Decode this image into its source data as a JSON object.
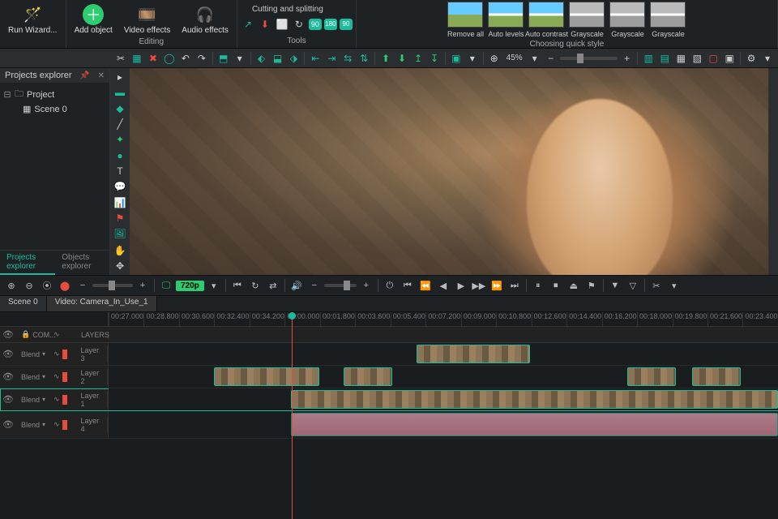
{
  "ribbon": {
    "run_wizard": "Run\nWizard...",
    "add_object": "Add\nobject",
    "video_effects": "Video\neffects",
    "audio_effects": "Audio\neffects",
    "editing_label": "Editing",
    "cutting_splitting": "Cutting and splitting",
    "tools_label": "Tools",
    "quick_styles": [
      "Remove all",
      "Auto levels",
      "Auto contrast",
      "Grayscale",
      "Grayscale",
      "Grayscale"
    ],
    "quick_style_label": "Choosing quick style"
  },
  "toolbar": {
    "zoom_value": "45%"
  },
  "projects_panel": {
    "title": "Projects explorer",
    "project": "Project",
    "scene": "Scene 0",
    "tabs": [
      "Projects explorer",
      "Objects explorer"
    ]
  },
  "transport": {
    "resolution": "720p"
  },
  "timeline": {
    "tabs": [
      "Scene 0",
      "Video: Camera_In_Use_1"
    ],
    "ruler": [
      "00:27.000",
      "00:28.800",
      "00:30.600",
      "00:32.400",
      "00:34.200",
      "00:00.000",
      "00:01.800",
      "00:03.600",
      "00:05.400",
      "00:07.200",
      "00:09.000",
      "00:10.800",
      "00:12.600",
      "00:14.400",
      "00:16.200",
      "00:18.000",
      "00:19.800",
      "00:21.600",
      "00:23.400"
    ],
    "header_cols": [
      "COM...",
      "LAYERS"
    ],
    "tracks": [
      {
        "blend": "Blend",
        "name": "Layer 3"
      },
      {
        "blend": "Blend",
        "name": "Layer 2"
      },
      {
        "blend": "Blend",
        "name": "Layer 1"
      },
      {
        "blend": "Blend",
        "name": "Layer 4"
      }
    ]
  }
}
